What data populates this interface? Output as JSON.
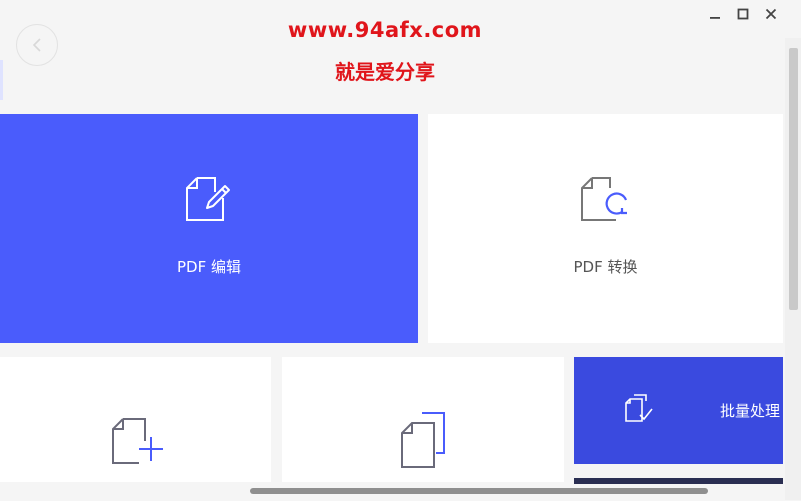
{
  "watermark": {
    "line1": "www.94afx.com",
    "line2": "就是爱分享"
  },
  "tiles": {
    "pdf_edit": {
      "label": "PDF 编辑",
      "icon": "document-edit-icon"
    },
    "pdf_convert": {
      "label": "PDF 转换",
      "icon": "document-convert-icon"
    },
    "create": {
      "icon": "document-add-icon"
    },
    "combine": {
      "icon": "documents-stack-icon"
    },
    "batch": {
      "label": "批量处理",
      "icon": "batch-documents-icon"
    }
  },
  "colors": {
    "primary_blue": "#4a5cfc",
    "batch_blue": "#3a4adf",
    "watermark_red": "#e0151b"
  }
}
